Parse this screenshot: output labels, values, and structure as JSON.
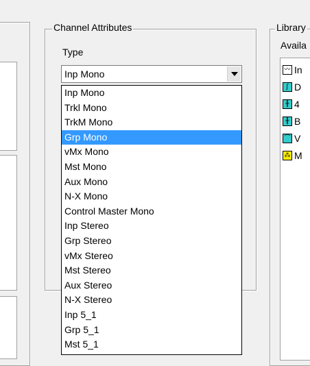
{
  "channel_attributes": {
    "group_title": "Channel Attributes",
    "type_label": "Type",
    "type_selected": "Inp Mono",
    "options": [
      "Inp Mono",
      "Trkl Mono",
      "TrkM Mono",
      "Grp Mono",
      "vMx Mono",
      "Mst Mono",
      "Aux Mono",
      "N-X Mono",
      "Control Master Mono",
      "Inp Stereo",
      "Grp Stereo",
      "vMx Stereo",
      "Mst Stereo",
      "Aux Stereo",
      "N-X Stereo",
      "Inp 5_1",
      "Grp 5_1",
      "Mst 5_1"
    ],
    "highlighted_option": "Grp Mono"
  },
  "library": {
    "group_title": "Library",
    "available_label": "Availa",
    "items": [
      {
        "label": "In",
        "icon": "waveform-icon",
        "color": "#ffffff"
      },
      {
        "label": "D",
        "icon": "dynamics-icon",
        "color": "#33cccc"
      },
      {
        "label": "4",
        "icon": "eq-icon",
        "color": "#33cccc"
      },
      {
        "label": "B",
        "icon": "eq-icon",
        "color": "#33cccc"
      },
      {
        "label": "V",
        "icon": "curve-icon",
        "color": "#33cccc"
      },
      {
        "label": "M",
        "icon": "meter-icon",
        "color": "#ffee00"
      }
    ]
  },
  "colors": {
    "selection": "#3399ff",
    "window_bg": "#f0f0f0"
  }
}
